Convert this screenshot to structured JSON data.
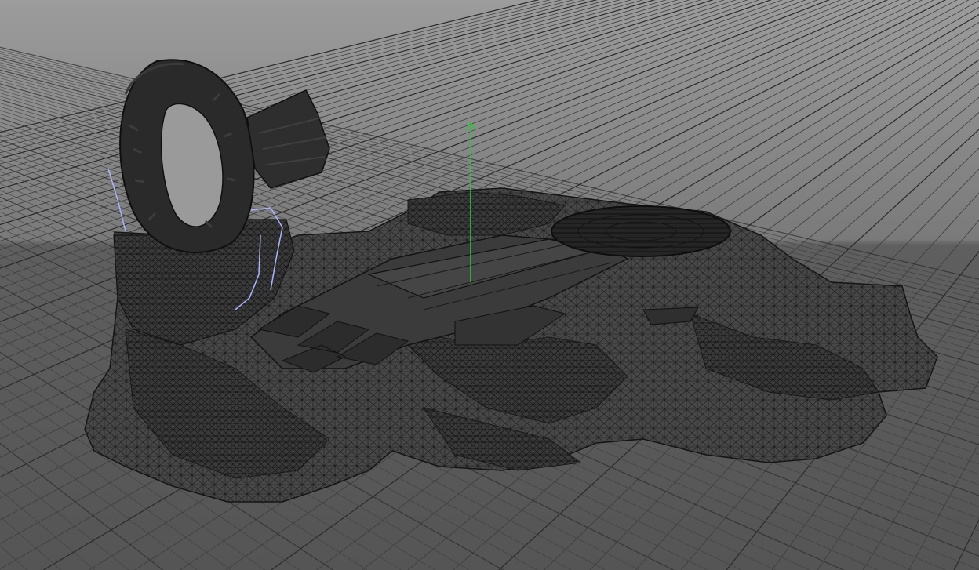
{
  "viewport": {
    "mode": "wireframe",
    "background_top": "#9a9a9a",
    "background_bottom": "#575757",
    "grid_color": "#3d3d3d",
    "grid_major_color": "#2a2a2a",
    "wire_color": "#1c1c1c",
    "mesh_fill": "#4a4a4a",
    "selection_color": "#aab4ff",
    "manipulator_color": "#22cc33",
    "manipulator_axis": "y"
  },
  "objects": [
    {
      "name": "portal-ring-icon"
    },
    {
      "name": "rock-base-icon"
    },
    {
      "name": "bridge-walkway-icon"
    },
    {
      "name": "circular-platform-icon"
    }
  ]
}
